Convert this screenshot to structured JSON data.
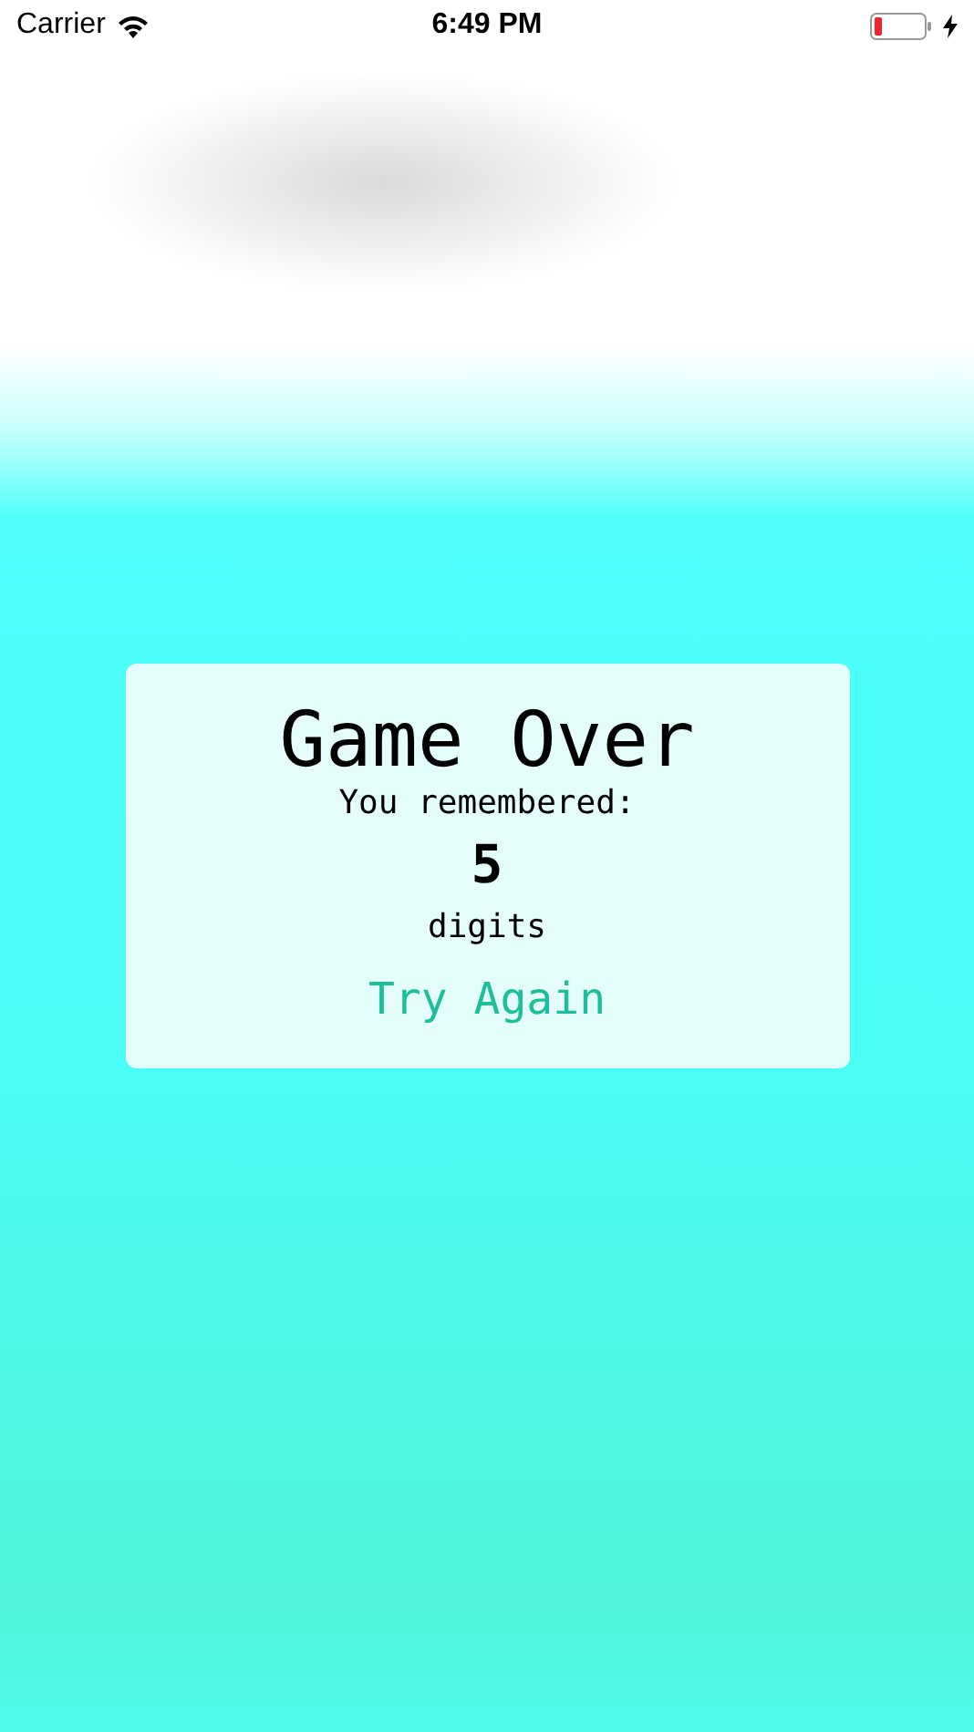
{
  "status_bar": {
    "carrier": "Carrier",
    "time": "6:49 PM",
    "charging": true
  },
  "result_card": {
    "title": "Game Over",
    "label": "You remembered:",
    "score": "5",
    "unit": "digits",
    "button": "Try Again"
  }
}
